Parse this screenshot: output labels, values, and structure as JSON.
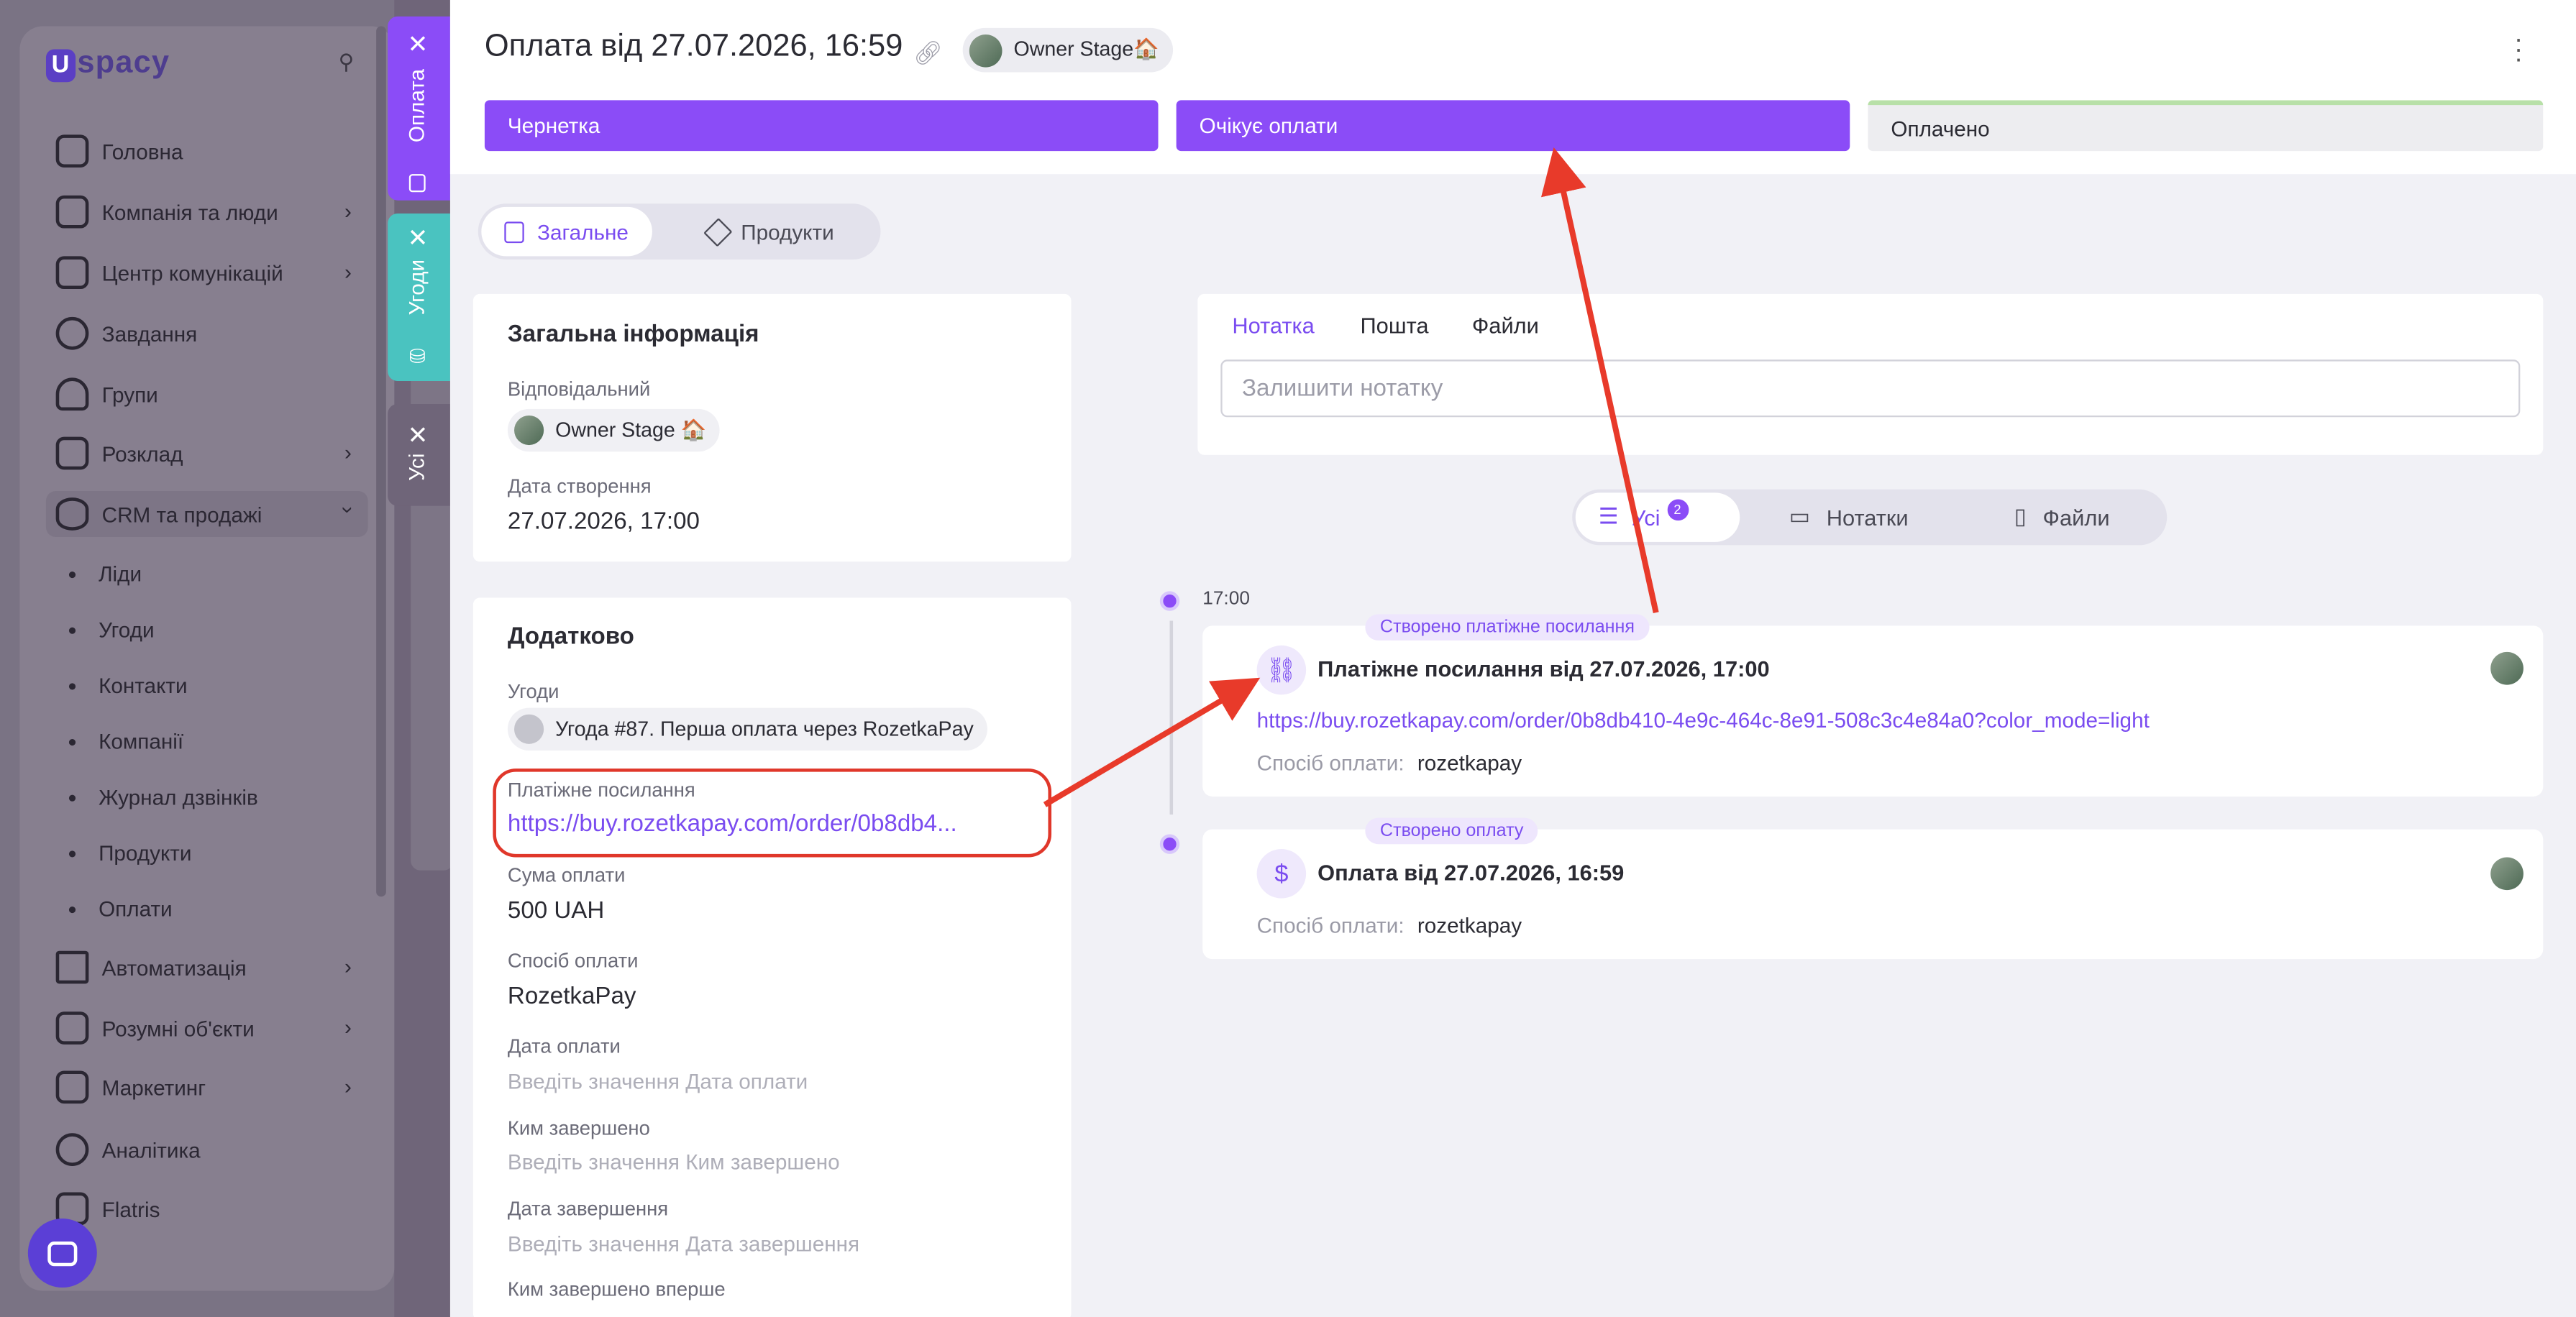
{
  "sidebar": {
    "logo": "spacy",
    "logo_letter": "U",
    "nav": [
      {
        "label": "Головна"
      },
      {
        "label": "Компанія та люди"
      },
      {
        "label": "Центр комунікацій"
      },
      {
        "label": "Завдання"
      },
      {
        "label": "Групи"
      },
      {
        "label": "Розклад"
      },
      {
        "label": "CRM та продажі"
      }
    ],
    "crm_sub": [
      "Ліди",
      "Угоди",
      "Контакти",
      "Компанії",
      "Журнал дзвінків",
      "Продукти",
      "Оплати"
    ],
    "nav_bottom": [
      {
        "label": "Автоматизація"
      },
      {
        "label": "Розумні об'єкти"
      },
      {
        "label": "Маркетинг"
      },
      {
        "label": "Аналітика"
      },
      {
        "label": "Flatris"
      }
    ]
  },
  "vtabs": [
    {
      "label": "Оплата",
      "color": "#8b4cf7"
    },
    {
      "label": "Угоди",
      "color": "#4ac3c0"
    },
    {
      "label": "Усі",
      "color": "#6f6579"
    }
  ],
  "header": {
    "title": "Оплата від 27.07.2026, 16:59",
    "owner": "Owner Stage🏠"
  },
  "stages": [
    {
      "label": "Чернетка",
      "state": "active"
    },
    {
      "label": "Очікує оплати",
      "state": "active"
    },
    {
      "label": "Оплачено",
      "state": "done"
    }
  ],
  "tabs": {
    "general": "Загальне",
    "products": "Продукти"
  },
  "general": {
    "heading": "Загальна інформація",
    "responsible_label": "Відповідальний",
    "responsible": "Owner Stage 🏠",
    "created_label": "Дата створення",
    "created": "27.07.2026, 17:00"
  },
  "extra": {
    "heading": "Додатково",
    "deals_label": "Угоди",
    "deal": "Угода #87. Перша оплата через RozetkaPay",
    "link_label": "Платіжне посилання",
    "link": "https://buy.rozetkapay.com/order/0b8db4...",
    "amount_label": "Сума оплати",
    "amount": "500 UAH",
    "method_label": "Спосіб оплати",
    "method": "RozetkaPay",
    "paydate_label": "Дата оплати",
    "paydate_ph": "Введіть значення Дата оплати",
    "doneby_label": "Ким завершено",
    "doneby_ph": "Введіть значення Ким завершено",
    "donedate_label": "Дата завершення",
    "donedate_ph": "Введіть значення Дата завершення",
    "firstdone_label": "Ким завершено вперше"
  },
  "note": {
    "tabs": [
      "Нотатка",
      "Пошта",
      "Файли"
    ],
    "placeholder": "Залишити нотатку"
  },
  "filter": {
    "all": "Усі",
    "all_count": "2",
    "notes": "Нотатки",
    "files": "Файли"
  },
  "timeline": {
    "time": "17:00",
    "events": [
      {
        "tag": "Створено платіжне посилання",
        "title": "Платіжне посилання від 27.07.2026, 17:00",
        "link": "https://buy.rozetkapay.com/order/0b8db410-4e9c-464c-8e91-508c3c4e84a0?color_mode=light",
        "meta_key": "Спосіб оплати:",
        "meta_val": "rozetkapay"
      },
      {
        "tag": "Створено оплату",
        "title": "Оплата від 27.07.2026, 16:59",
        "meta_key": "Спосіб оплати:",
        "meta_val": "rozetkapay"
      }
    ]
  },
  "colors": {
    "accent": "#8b4cf7",
    "annotation": "#e0372a"
  }
}
